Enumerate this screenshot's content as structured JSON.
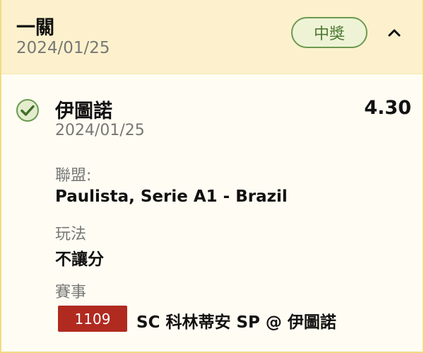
{
  "header": {
    "title": "一關",
    "date": "2024/01/25",
    "status_label": "中獎"
  },
  "selection": {
    "name": "伊圖諾",
    "date": "2024/01/25",
    "odds": "4.30",
    "result_icon": "check-circle-icon",
    "league_label": "聯盟:",
    "league_value": "Paulista, Serie A1 - Brazil",
    "market_label": "玩法",
    "market_value": "不讓分",
    "event_label": "賽事",
    "event_id": "1109",
    "event_name": "SC 科林蒂安 SP @ 伊圖諾"
  },
  "colors": {
    "header_bg": "#fcf1cc",
    "card_bg": "#fffdf3",
    "win_green": "#4d7a32",
    "event_id_bg": "#b02a20",
    "border": "#f0dc84"
  }
}
